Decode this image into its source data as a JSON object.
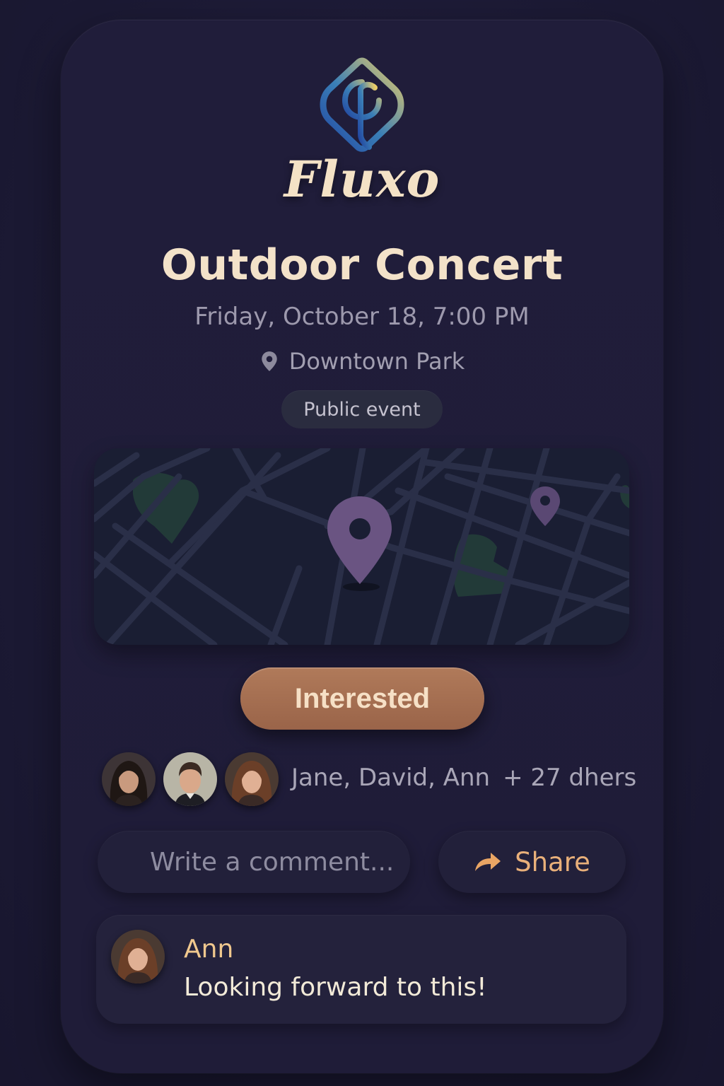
{
  "brand": {
    "name": "Fluxo",
    "logo_icon": "fluxo-logo-icon",
    "colors": {
      "logo_gradient_start": "#2c5cad",
      "logo_gradient_end": "#e8c765"
    }
  },
  "event": {
    "title": "Outdoor Concert",
    "datetime": "Friday, October 18, 7:00 PM",
    "location": "Downtown Park",
    "location_icon": "map-pin-icon",
    "visibility_badge": "Public event"
  },
  "map": {
    "pin_icon": "map-pin-icon",
    "colors": {
      "background": "#1a1e33",
      "roads": "#2a2f48",
      "parks": "#223a38",
      "pin": "#6a5482"
    }
  },
  "actions": {
    "interested_label": "Interested",
    "share_label": "Share",
    "share_icon": "share-arrow-icon",
    "comment_placeholder": "Write a comment..."
  },
  "attendees": {
    "names": "Jane, David, Ann",
    "more": "+ 27 dhers",
    "avatars": [
      {
        "name": "Jane",
        "icon": "avatar-jane"
      },
      {
        "name": "David",
        "icon": "avatar-david"
      },
      {
        "name": "Ann",
        "icon": "avatar-ann"
      }
    ]
  },
  "comments": [
    {
      "author": "Ann",
      "text": "Looking forward to this!",
      "avatar": "avatar-ann"
    }
  ],
  "colors": {
    "accent": "#b07a5a",
    "title": "#f3e2c9",
    "share": "#e9b07a",
    "author": "#f0c88e"
  }
}
